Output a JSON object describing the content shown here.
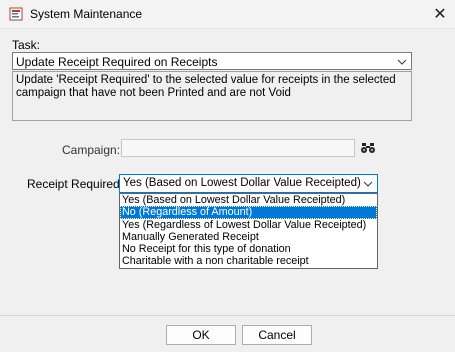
{
  "window": {
    "title": "System Maintenance",
    "close_glyph": "✕"
  },
  "task": {
    "label": "Task:",
    "selected": "Update Receipt Required on Receipts",
    "description": "Update 'Receipt Required' to the selected value for receipts in the selected campaign that have not been Printed and are not Void"
  },
  "campaign": {
    "label": "Campaign:",
    "value": "",
    "search_icon": "binoculars-icon"
  },
  "receipt_required": {
    "label": "Receipt Required:",
    "selected": "Yes (Based on Lowest Dollar Value Receipted)",
    "options": [
      "Yes (Based on Lowest Dollar Value Receipted)",
      "No (Regardless of Amount)",
      "Yes (Regardless of Lowest Dollar Value Receipted)",
      "Manually Generated Receipt",
      "No Receipt for this type of donation",
      "Charitable with a non charitable receipt"
    ],
    "highlighted_index": 1
  },
  "buttons": {
    "ok": "OK",
    "cancel": "Cancel"
  },
  "colors": {
    "accent": "#0078d7",
    "window_bg": "#f0f0f0"
  }
}
